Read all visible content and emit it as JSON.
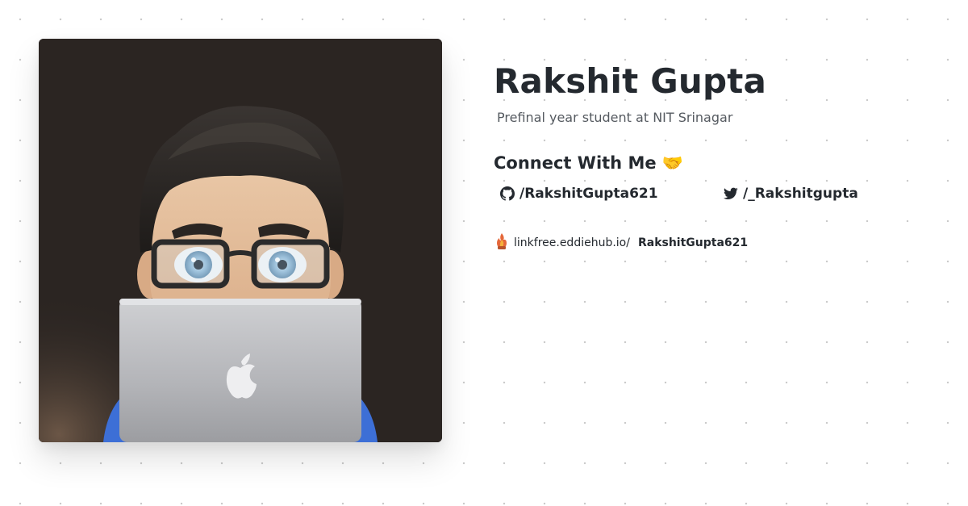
{
  "profile": {
    "name": "Rakshit Gupta",
    "tagline": "Prefinal year student at NIT Srinagar"
  },
  "connect": {
    "heading": "Connect With Me 🤝",
    "links": [
      {
        "icon": "github-icon",
        "label": "/RakshitGupta621"
      },
      {
        "icon": "twitter-icon",
        "label": "/_Rakshitgupta"
      }
    ]
  },
  "linkfree": {
    "icon": "flame-icon",
    "prefix": "linkfree.eddiehub.io/",
    "username": "RakshitGupta621"
  },
  "colors": {
    "text": "#24292f",
    "muted": "#555a60",
    "avatar_background": "#2b2522"
  }
}
